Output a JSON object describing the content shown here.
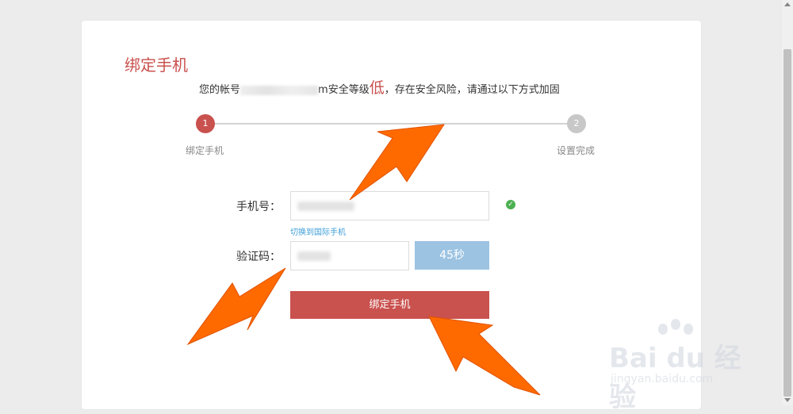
{
  "page": {
    "title": "绑定手机",
    "notice_prefix": "您的帐号",
    "notice_masked_suffix": "m",
    "notice_middle": "安全等级",
    "security_level": "低",
    "notice_suffix": "，存在安全风险，请通过以下方式加固"
  },
  "steps": [
    {
      "number": "1",
      "label": "绑定手机",
      "state": "active"
    },
    {
      "number": "2",
      "label": "设置完成",
      "state": "pending"
    }
  ],
  "form": {
    "phone_label": "手机号：",
    "phone_value_masked": true,
    "switch_link": "切换到国际手机",
    "code_label": "验证码：",
    "code_value_masked": true,
    "countdown_label": "45秒",
    "submit_label": "绑定手机"
  },
  "watermark": {
    "logo_text": "Bai du 经验",
    "url": "jingyan.baidu.com"
  },
  "colors": {
    "accent": "#c9514e",
    "link": "#3f9fd8",
    "countdown_bg": "#9cc3e2",
    "step_pending": "#c8c8c8",
    "success": "#4caf50",
    "arrow": "#ff6a00"
  }
}
